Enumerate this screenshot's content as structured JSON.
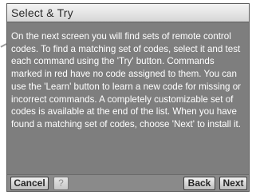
{
  "dialog": {
    "title": "Select & Try",
    "body": "On the next screen you will find sets of remote control codes. To find a matching set of codes, select it and test each command using the 'Try' button. Commands marked in red have no code assigned to them. You can use the 'Learn' button to learn a new code for missing or incorrect commands. A completely customizable set of codes is available at the end of the list. When you have found a matching set of codes, choose 'Next' to install it."
  },
  "buttons": {
    "cancel": "Cancel",
    "help": "?",
    "back": "Back",
    "next": "Next"
  },
  "colors": {
    "panel": "#7e7e7e",
    "text": "#ffffff",
    "titlebar": "#e6e6e6"
  }
}
